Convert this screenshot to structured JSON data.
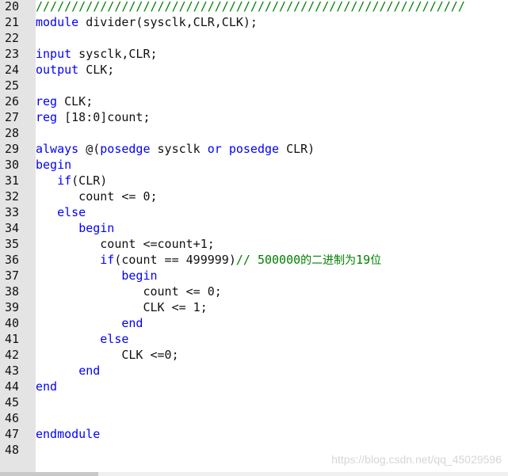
{
  "editor": {
    "lines": [
      {
        "num": "20",
        "tokens": [
          {
            "t": "cm",
            "v": "////////////////////////////////////////////////////////////"
          }
        ]
      },
      {
        "num": "21",
        "tokens": [
          {
            "t": "kw",
            "v": "module"
          },
          {
            "t": "pl",
            "v": " divider(sysclk,CLR,CLK);"
          }
        ]
      },
      {
        "num": "22",
        "tokens": []
      },
      {
        "num": "23",
        "tokens": [
          {
            "t": "kw",
            "v": "input"
          },
          {
            "t": "pl",
            "v": " sysclk,CLR;"
          }
        ]
      },
      {
        "num": "24",
        "tokens": [
          {
            "t": "kw",
            "v": "output"
          },
          {
            "t": "pl",
            "v": " CLK;"
          }
        ]
      },
      {
        "num": "25",
        "tokens": []
      },
      {
        "num": "26",
        "tokens": [
          {
            "t": "kw",
            "v": "reg"
          },
          {
            "t": "pl",
            "v": " CLK;"
          }
        ]
      },
      {
        "num": "27",
        "tokens": [
          {
            "t": "kw",
            "v": "reg"
          },
          {
            "t": "pl",
            "v": " [18:0]count;"
          }
        ]
      },
      {
        "num": "28",
        "tokens": []
      },
      {
        "num": "29",
        "tokens": [
          {
            "t": "kw",
            "v": "always"
          },
          {
            "t": "pl",
            "v": " @("
          },
          {
            "t": "kw",
            "v": "posedge"
          },
          {
            "t": "pl",
            "v": " sysclk "
          },
          {
            "t": "kw",
            "v": "or"
          },
          {
            "t": "pl",
            "v": " "
          },
          {
            "t": "kw",
            "v": "posedge"
          },
          {
            "t": "pl",
            "v": " CLR)"
          }
        ]
      },
      {
        "num": "30",
        "tokens": [
          {
            "t": "kw",
            "v": "begin"
          }
        ]
      },
      {
        "num": "31",
        "tokens": [
          {
            "t": "pl",
            "v": "   "
          },
          {
            "t": "kw",
            "v": "if"
          },
          {
            "t": "pl",
            "v": "(CLR)"
          }
        ]
      },
      {
        "num": "32",
        "tokens": [
          {
            "t": "pl",
            "v": "      count <= 0;"
          }
        ]
      },
      {
        "num": "33",
        "tokens": [
          {
            "t": "pl",
            "v": "   "
          },
          {
            "t": "kw",
            "v": "else"
          }
        ]
      },
      {
        "num": "34",
        "tokens": [
          {
            "t": "pl",
            "v": "      "
          },
          {
            "t": "kw",
            "v": "begin"
          }
        ]
      },
      {
        "num": "35",
        "tokens": [
          {
            "t": "pl",
            "v": "         count <=count+1;"
          }
        ]
      },
      {
        "num": "36",
        "tokens": [
          {
            "t": "pl",
            "v": "         "
          },
          {
            "t": "kw",
            "v": "if"
          },
          {
            "t": "pl",
            "v": "(count == 499999)"
          },
          {
            "t": "cm",
            "v": "// 500000"
          },
          {
            "t": "cmzh",
            "v": "的二进制为"
          },
          {
            "t": "cm",
            "v": "19"
          },
          {
            "t": "cmzh",
            "v": "位"
          }
        ]
      },
      {
        "num": "37",
        "tokens": [
          {
            "t": "pl",
            "v": "            "
          },
          {
            "t": "kw",
            "v": "begin"
          }
        ]
      },
      {
        "num": "38",
        "tokens": [
          {
            "t": "pl",
            "v": "               count <= 0;"
          }
        ]
      },
      {
        "num": "39",
        "tokens": [
          {
            "t": "pl",
            "v": "               CLK <= 1;"
          }
        ]
      },
      {
        "num": "40",
        "tokens": [
          {
            "t": "pl",
            "v": "            "
          },
          {
            "t": "kw",
            "v": "end"
          }
        ]
      },
      {
        "num": "41",
        "tokens": [
          {
            "t": "pl",
            "v": "         "
          },
          {
            "t": "kw",
            "v": "else"
          }
        ]
      },
      {
        "num": "42",
        "tokens": [
          {
            "t": "pl",
            "v": "            CLK <=0;"
          }
        ]
      },
      {
        "num": "43",
        "tokens": [
          {
            "t": "pl",
            "v": "      "
          },
          {
            "t": "kw",
            "v": "end"
          }
        ]
      },
      {
        "num": "44",
        "tokens": [
          {
            "t": "kw",
            "v": "end"
          }
        ]
      },
      {
        "num": "45",
        "tokens": []
      },
      {
        "num": "46",
        "tokens": []
      },
      {
        "num": "47",
        "tokens": [
          {
            "t": "kw",
            "v": "endmodule"
          }
        ]
      },
      {
        "num": "48",
        "tokens": []
      }
    ]
  },
  "watermark": "https://blog.csdn.net/qq_45029596",
  "colors": {
    "keyword": "#0000ff",
    "comment": "#008000",
    "text": "#111111",
    "gutter": "#e4e4e4",
    "background": "#ffffff"
  }
}
